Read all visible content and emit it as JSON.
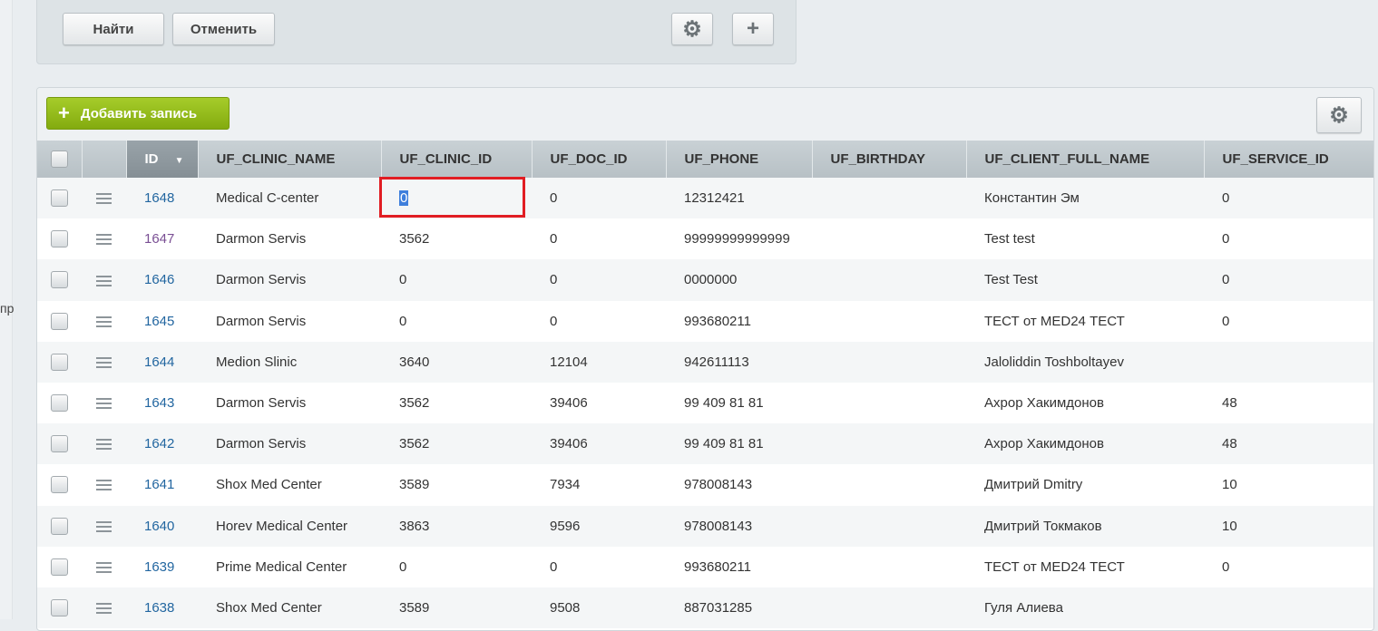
{
  "left_strip": {
    "text": "пр"
  },
  "filter": {
    "find_label": "Найти",
    "cancel_label": "Отменить",
    "gear_icon": "⚙",
    "plus_icon": "+"
  },
  "toolbar": {
    "add_label": "Добавить запись",
    "add_icon": "+",
    "gear_icon": "⚙"
  },
  "table": {
    "columns": [
      "ID",
      "UF_CLINIC_NAME",
      "UF_CLINIC_ID",
      "UF_DOC_ID",
      "UF_PHONE",
      "UF_BIRTHDAY",
      "UF_CLIENT_FULL_NAME",
      "UF_SERVICE_ID"
    ],
    "sort_icon": "▼",
    "rows": [
      [
        "1648",
        "Medical C-center",
        "0",
        "0",
        "12312421",
        "",
        "Константин Эм",
        "0"
      ],
      [
        "1647",
        "Darmon Servis",
        "3562",
        "0",
        "99999999999999",
        "",
        "Test test",
        "0"
      ],
      [
        "1646",
        "Darmon Servis",
        "0",
        "0",
        "0000000",
        "",
        "Test Test",
        "0"
      ],
      [
        "1645",
        "Darmon Servis",
        "0",
        "0",
        "993680211",
        "",
        "ТЕСТ от MED24 ТЕСТ",
        "0"
      ],
      [
        "1644",
        "Medion Slinic",
        "3640",
        "12104",
        "942611113",
        "",
        "Jaloliddin Toshboltayev",
        ""
      ],
      [
        "1643",
        "Darmon Servis",
        "3562",
        "39406",
        "99 409 81 81",
        "",
        "Ахрор Хакимдонов",
        "48"
      ],
      [
        "1642",
        "Darmon Servis",
        "3562",
        "39406",
        "99 409 81 81",
        "",
        "Ахрор Хакимдонов",
        "48"
      ],
      [
        "1641",
        "Shox Med Center",
        "3589",
        "7934",
        "978008143",
        "",
        "Дмитрий Dmitry",
        "10"
      ],
      [
        "1640",
        "Horev Medical Center",
        "3863",
        "9596",
        "978008143",
        "",
        "Дмитрий Токмаков",
        "10"
      ],
      [
        "1639",
        "Prime Medical Center",
        "0",
        "0",
        "993680211",
        "",
        "ТЕСТ от MED24 ТЕСТ",
        "0"
      ],
      [
        "1638",
        "Shox Med Center",
        "3589",
        "9508",
        "887031285",
        "",
        "Гуля Алиева",
        ""
      ]
    ]
  }
}
